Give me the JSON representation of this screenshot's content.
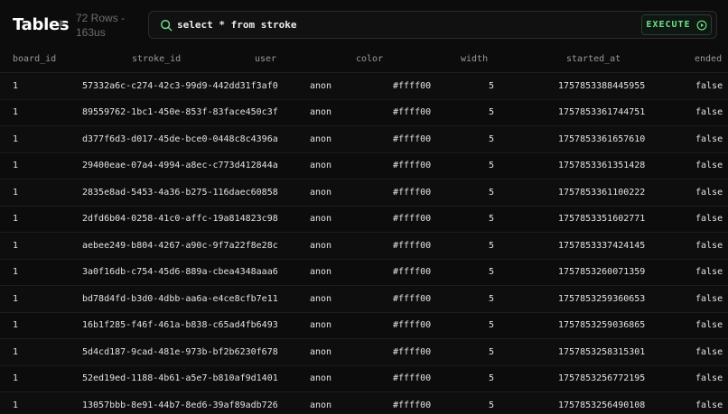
{
  "header": {
    "title": "Tables",
    "rows_count": "72 Rows -",
    "duration": "163us"
  },
  "query": {
    "value": "select * from stroke",
    "execute_label": "EXECUTE"
  },
  "colors": {
    "accent": "#6fe08a",
    "background": "#0c0c0c"
  },
  "table": {
    "columns": [
      "board_id",
      "stroke_id",
      "user",
      "color",
      "width",
      "started_at",
      "ended"
    ],
    "rows": [
      [
        "1",
        "57332a6c-c274-42c3-99d9-442dd31f3af0",
        "anon",
        "#ffff00",
        "5",
        "1757853388445955",
        "false"
      ],
      [
        "1",
        "89559762-1bc1-450e-853f-83face450c3f",
        "anon",
        "#ffff00",
        "5",
        "1757853361744751",
        "false"
      ],
      [
        "1",
        "d377f6d3-d017-45de-bce0-0448c8c4396a",
        "anon",
        "#ffff00",
        "5",
        "1757853361657610",
        "false"
      ],
      [
        "1",
        "29400eae-07a4-4994-a8ec-c773d412844a",
        "anon",
        "#ffff00",
        "5",
        "1757853361351428",
        "false"
      ],
      [
        "1",
        "2835e8ad-5453-4a36-b275-116daec60858",
        "anon",
        "#ffff00",
        "5",
        "1757853361100222",
        "false"
      ],
      [
        "1",
        "2dfd6b04-0258-41c0-affc-19a814823c98",
        "anon",
        "#ffff00",
        "5",
        "1757853351602771",
        "false"
      ],
      [
        "1",
        "aebee249-b804-4267-a90c-9f7a22f8e28c",
        "anon",
        "#ffff00",
        "5",
        "1757853337424145",
        "false"
      ],
      [
        "1",
        "3a0f16db-c754-45d6-889a-cbea4348aaa6",
        "anon",
        "#ffff00",
        "5",
        "1757853260071359",
        "false"
      ],
      [
        "1",
        "bd78d4fd-b3d0-4dbb-aa6a-e4ce8cfb7e11",
        "anon",
        "#ffff00",
        "5",
        "1757853259360653",
        "false"
      ],
      [
        "1",
        "16b1f285-f46f-461a-b838-c65ad4fb6493",
        "anon",
        "#ffff00",
        "5",
        "1757853259036865",
        "false"
      ],
      [
        "1",
        "5d4cd187-9cad-481e-973b-bf2b6230f678",
        "anon",
        "#ffff00",
        "5",
        "1757853258315301",
        "false"
      ],
      [
        "1",
        "52ed19ed-1188-4b61-a5e7-b810af9d1401",
        "anon",
        "#ffff00",
        "5",
        "1757853256772195",
        "false"
      ],
      [
        "1",
        "13057bbb-8e91-44b7-8ed6-39af89adb726",
        "anon",
        "#ffff00",
        "5",
        "1757853256490108",
        "false"
      ]
    ]
  }
}
